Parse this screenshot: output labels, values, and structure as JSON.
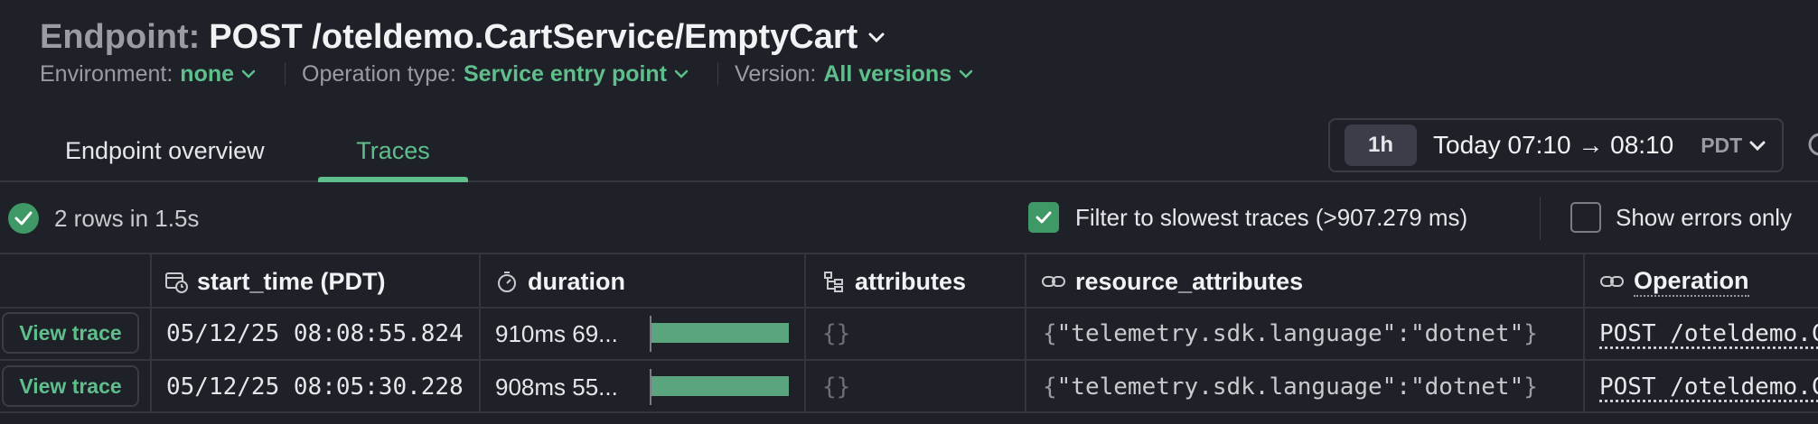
{
  "header": {
    "prefix": "Endpoint:",
    "endpoint": "POST /oteldemo.CartService/EmptyCart",
    "meta": {
      "environment_label": "Environment:",
      "environment_value": "none",
      "operation_label": "Operation type:",
      "operation_value": "Service entry point",
      "version_label": "Version:",
      "version_value": "All versions"
    }
  },
  "tabs": [
    {
      "label": "Endpoint overview",
      "active": false
    },
    {
      "label": "Traces",
      "active": true
    }
  ],
  "time_picker": {
    "preset": "1h",
    "range": "Today 07:10 → 08:10",
    "timezone": "PDT"
  },
  "status": {
    "summary": "2 rows in 1.5s",
    "filter_slowest": {
      "label": "Filter to slowest traces (>907.279 ms)",
      "checked": true
    },
    "show_errors": {
      "label": "Show errors only",
      "checked": false
    }
  },
  "table": {
    "columns": {
      "start_time": "start_time (PDT)",
      "duration": "duration",
      "attributes": "attributes",
      "resource_attributes": "resource_attributes",
      "operation": "Operation"
    },
    "rows": [
      {
        "action": "View trace",
        "start_time": "05/12/25 08:08:55.824",
        "duration": "910ms 69...",
        "duration_bar_fraction": 1.0,
        "attributes": "{}",
        "res_open": "{",
        "res_key": "\"telemetry.sdk.language\"",
        "res_colon": ":",
        "res_value": "\"dotnet\"",
        "res_close": "}",
        "operation": "POST /oteldemo.C"
      },
      {
        "action": "View trace",
        "start_time": "05/12/25 08:05:30.228",
        "duration": "908ms 55...",
        "duration_bar_fraction": 0.998,
        "attributes": "{}",
        "res_open": "{",
        "res_key": "\"telemetry.sdk.language\"",
        "res_colon": ":",
        "res_value": "\"dotnet\"",
        "res_close": "}",
        "operation": "POST /oteldemo.C"
      }
    ]
  },
  "colors": {
    "background": "#1f2128",
    "accent": "#5fbf8c",
    "bar": "#5aa57e",
    "border": "#33363e"
  }
}
